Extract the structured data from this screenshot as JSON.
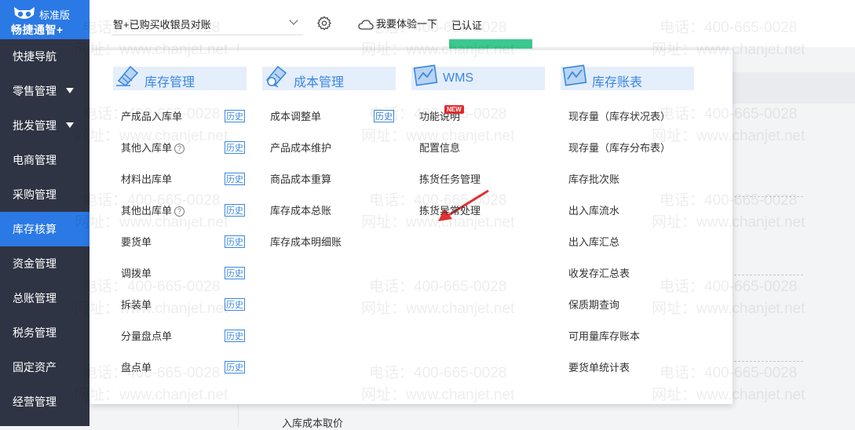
{
  "brand": {
    "edition": "标准版",
    "name": "畅捷通智+"
  },
  "sidebar": {
    "items": [
      {
        "label": "快捷导航",
        "has_caret": false,
        "active": false
      },
      {
        "label": "零售管理",
        "has_caret": true,
        "active": false
      },
      {
        "label": "批发管理",
        "has_caret": true,
        "active": false
      },
      {
        "label": "电商管理",
        "has_caret": false,
        "active": false
      },
      {
        "label": "采购管理",
        "has_caret": false,
        "active": false
      },
      {
        "label": "库存核算",
        "has_caret": false,
        "active": true
      },
      {
        "label": "资金管理",
        "has_caret": false,
        "active": false
      },
      {
        "label": "总账管理",
        "has_caret": false,
        "active": false
      },
      {
        "label": "税务管理",
        "has_caret": false,
        "active": false
      },
      {
        "label": "固定资产",
        "has_caret": false,
        "active": false
      },
      {
        "label": "经营管理",
        "has_caret": false,
        "active": false
      }
    ]
  },
  "topbar": {
    "account_select": "智+已购买收银员对账",
    "trial_label": "我要体验一下",
    "verified_label": "已认证"
  },
  "background": {
    "partial_text": "入库成本取价"
  },
  "menu": {
    "history_label": "历史",
    "new_badge": "NEW",
    "columns": [
      {
        "title": "库存管理",
        "icon": "inventory-doc-icon",
        "items": [
          {
            "label": "产成品入库单",
            "history": true,
            "help": false
          },
          {
            "label": "其他入库单",
            "history": true,
            "help": true
          },
          {
            "label": "材料出库单",
            "history": true,
            "help": false
          },
          {
            "label": "其他出库单",
            "history": true,
            "help": true
          },
          {
            "label": "要货单",
            "history": true,
            "help": false
          },
          {
            "label": "调拨单",
            "history": true,
            "help": false
          },
          {
            "label": "拆装单",
            "history": true,
            "help": false
          },
          {
            "label": "分量盘点单",
            "history": true,
            "help": false
          },
          {
            "label": "盘点单",
            "history": true,
            "help": false
          }
        ]
      },
      {
        "title": "成本管理",
        "icon": "cost-doc-icon",
        "items": [
          {
            "label": "成本调整单",
            "history": true,
            "help": false
          },
          {
            "label": "产品成本维护",
            "history": false,
            "help": false
          },
          {
            "label": "商品成本重算",
            "history": false,
            "help": false
          },
          {
            "label": "库存成本总账",
            "history": false,
            "help": false
          },
          {
            "label": "库存成本明细账",
            "history": false,
            "help": false
          }
        ]
      },
      {
        "title": "WMS",
        "icon": "wms-chart-icon",
        "items": [
          {
            "label": "功能说明",
            "history": false,
            "help": false,
            "badge": true
          },
          {
            "label": "配置信息",
            "history": false,
            "help": false
          },
          {
            "label": "拣货任务管理",
            "history": false,
            "help": false
          },
          {
            "label": "拣货异常处理",
            "history": false,
            "help": false
          }
        ]
      },
      {
        "title": "库存账表",
        "icon": "ledger-chart-icon",
        "items": [
          {
            "label": "现存量（库存状况表）",
            "history": false,
            "help": false
          },
          {
            "label": "现存量（库存分布表）",
            "history": false,
            "help": false
          },
          {
            "label": "库存批次账",
            "history": false,
            "help": false
          },
          {
            "label": "出入库流水",
            "history": false,
            "help": false
          },
          {
            "label": "出入库汇总",
            "history": false,
            "help": false
          },
          {
            "label": "收发存汇总表",
            "history": false,
            "help": false
          },
          {
            "label": "保质期查询",
            "history": false,
            "help": false
          },
          {
            "label": "可用量库存账本",
            "history": false,
            "help": false
          },
          {
            "label": "要货单统计表",
            "history": false,
            "help": false
          }
        ]
      }
    ]
  },
  "watermark": {
    "phone": "电话：400-665-0028",
    "site": "网址：www.chanjet.net"
  },
  "colors": {
    "primary": "#2b79e5",
    "sidebar_bg": "#2f3444",
    "accent_blue": "#3a88e0",
    "badge_red": "#e52d2d",
    "green": "#3bc98e"
  }
}
